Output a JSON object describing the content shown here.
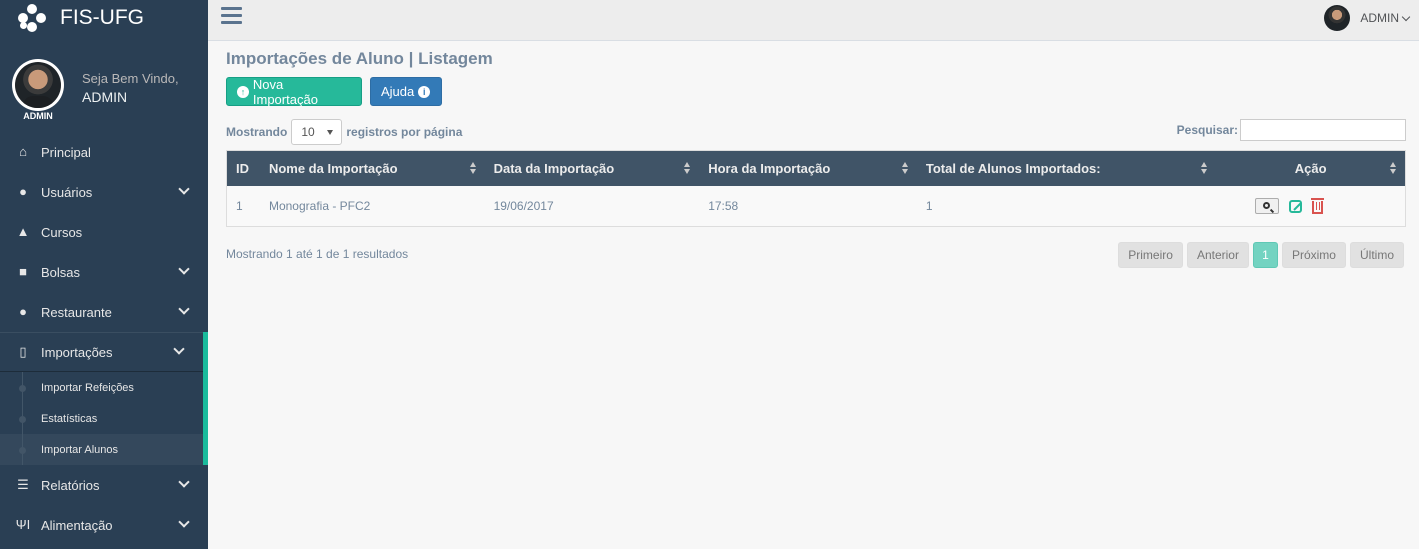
{
  "brand": {
    "title": "FIS-UFG"
  },
  "profile": {
    "welcome": "Seja Bem Vindo,",
    "name": "ADMIN",
    "badge": "ADMIN"
  },
  "sidebar": {
    "items": [
      {
        "label": "Principal",
        "icon": "home-icon"
      },
      {
        "label": "Usuários",
        "icon": "user-icon"
      },
      {
        "label": "Cursos",
        "icon": "graduation-cap-icon"
      },
      {
        "label": "Bolsas",
        "icon": "briefcase-icon"
      },
      {
        "label": "Restaurante",
        "icon": "user-icon"
      },
      {
        "label": "Importações",
        "icon": "file-icon"
      },
      {
        "label": "Relatórios",
        "icon": "list-icon"
      },
      {
        "label": "Alimentação",
        "icon": "cutlery-icon"
      }
    ],
    "submenu": [
      {
        "label": "Importar Refeições"
      },
      {
        "label": "Estatísticas"
      },
      {
        "label": "Importar Alunos"
      }
    ]
  },
  "topnav": {
    "user": "ADMIN"
  },
  "page": {
    "title": "Importações de Aluno | Listagem",
    "new_button": "Nova Importação",
    "help_button": "Ajuda"
  },
  "table_controls": {
    "show_prefix": "Mostrando",
    "page_length": "10",
    "show_suffix": "registros por página",
    "search_label": "Pesquisar:"
  },
  "table": {
    "headers": [
      "ID",
      "Nome da Importação",
      "Data da Importação",
      "Hora da Importação",
      "Total de Alunos Importados:",
      "Ação"
    ],
    "rows": [
      {
        "id": "1",
        "nome": "Monografia - PFC2",
        "data": "19/06/2017",
        "hora": "17:58",
        "total": "1"
      }
    ]
  },
  "footer": {
    "info": "Mostrando 1 até 1 de 1 resultados",
    "pagination": {
      "first": "Primeiro",
      "prev": "Anterior",
      "current": "1",
      "next": "Próximo",
      "last": "Último"
    }
  },
  "colors": {
    "sidebar": "#2a3f54",
    "accent": "#26b99a",
    "help": "#337ab7",
    "header": "#34495e",
    "danger": "#d9534f"
  }
}
